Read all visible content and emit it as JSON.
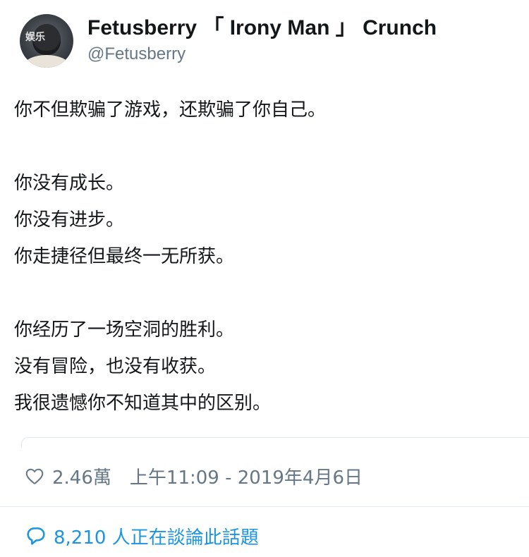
{
  "author": {
    "display_name": "Fetusberry 「 Irony Man 」 Crunch",
    "handle": "@Fetusberry",
    "avatar_watermark": "娱乐"
  },
  "tweet": {
    "lines": [
      "你不但欺骗了游戏，还欺骗了你自己。",
      "",
      "你没有成长。",
      "你没有进步。",
      "你走捷径但最终一无所获。",
      "",
      "你经历了一场空洞的胜利。",
      "没有冒险，也没有收获。",
      "我很遗憾你不知道其中的区别。"
    ]
  },
  "meta": {
    "like_count": "2.46萬",
    "timestamp": "上午11:09 - 2019年4月6日"
  },
  "conversation": {
    "text": "8,210 人正在談論此話題"
  },
  "colors": {
    "text": "#14171a",
    "secondary": "#657786",
    "link": "#1b95e0",
    "divider": "#e6ecf0"
  },
  "icons": {
    "like": "heart-icon",
    "conversation": "reply-icon"
  }
}
